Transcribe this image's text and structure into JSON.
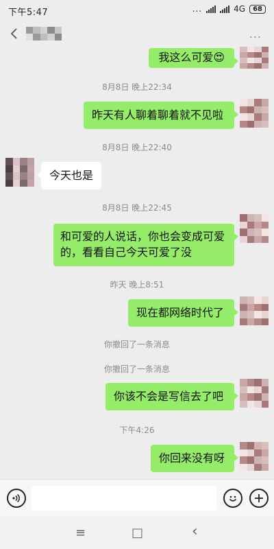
{
  "status_bar": {
    "time": "下午5:47",
    "dots": "...",
    "network": "4G",
    "battery": "68"
  },
  "nav": {
    "back_icon": "chevron-left-icon",
    "more_icon": "ellipsis-icon",
    "more_label": "..."
  },
  "messages": [
    {
      "type": "bubble",
      "side": "out",
      "text": "我这么可爱😍"
    },
    {
      "type": "time",
      "text": "8月8日 晚上22:34"
    },
    {
      "type": "bubble",
      "side": "out",
      "text": "昨天有人聊着聊着就不见啦"
    },
    {
      "type": "time",
      "text": "8月8日 晚上22:40"
    },
    {
      "type": "bubble",
      "side": "in",
      "text": "今天也是"
    },
    {
      "type": "time",
      "text": "8月8日 晚上22:45"
    },
    {
      "type": "bubble",
      "side": "out",
      "text": "和可爱的人说话，你也会变成可爱的，看看自己今天可爱了没"
    },
    {
      "type": "time",
      "text": "昨天 晚上8:51"
    },
    {
      "type": "bubble",
      "side": "out",
      "text": "现在都网络时代了"
    },
    {
      "type": "notice",
      "text": "你撤回了一条消息"
    },
    {
      "type": "notice",
      "text": "你撤回了一条消息"
    },
    {
      "type": "bubble",
      "side": "out",
      "text": "你该不会是写信去了吧"
    },
    {
      "type": "time",
      "text": "下午4:26"
    },
    {
      "type": "bubble",
      "side": "out",
      "text": "你回来没有呀"
    }
  ],
  "input_bar": {
    "voice_icon": "voice-icon",
    "emoji_icon": "emoji-icon",
    "plus_icon": "plus-icon",
    "input_value": ""
  },
  "system_nav": {
    "menu_icon": "≡",
    "home_icon": "□",
    "back_icon": "‹"
  },
  "colors": {
    "background": "#ededed",
    "outgoing_bubble": "#95ec69",
    "incoming_bubble": "#ffffff",
    "timestamp_text": "#8a8a8a"
  }
}
